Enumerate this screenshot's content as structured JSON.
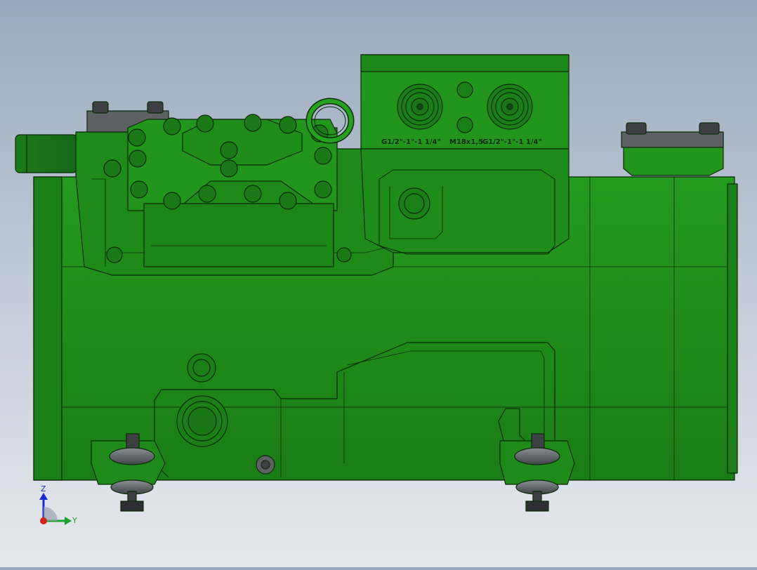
{
  "viewport": {
    "background_top": "#9aa9bd",
    "background_bottom": "#e6e9ee",
    "body_color": "#1f8a1a",
    "body_dark": "#176b13",
    "edge_color": "#0b2a08",
    "metal_color": "#5a5f62"
  },
  "port_labels": {
    "left": "G1/2\"-1\"-1 1/4\"",
    "middle": "M18x1,5",
    "right": "G1/2\"-1\"-1 1/4\""
  },
  "triad": {
    "z_label": "Z",
    "y_label": "Y",
    "z_color": "#1a2bd6",
    "y_color": "#1aa12b",
    "x_color": "#d6231a"
  }
}
